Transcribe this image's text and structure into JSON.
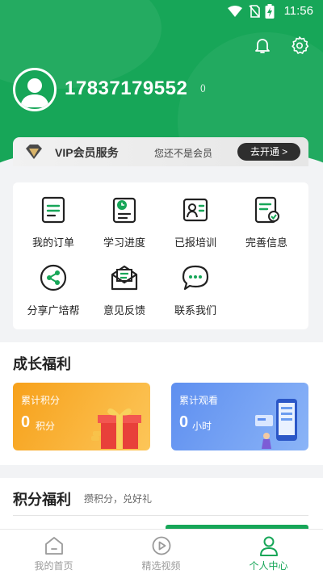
{
  "status_bar": {
    "time": "11:56"
  },
  "profile": {
    "phone": "17837179552",
    "tag": "()"
  },
  "vip": {
    "title": "VIP会员服务",
    "status": "您还不是会员",
    "button": "去开通 >"
  },
  "menu": [
    {
      "label": "我的订单",
      "icon": "order-icon"
    },
    {
      "label": "学习进度",
      "icon": "progress-icon"
    },
    {
      "label": "已报培训",
      "icon": "training-icon"
    },
    {
      "label": "完善信息",
      "icon": "profile-info-icon"
    },
    {
      "label": "分享广培帮",
      "icon": "share-icon"
    },
    {
      "label": "意见反馈",
      "icon": "feedback-icon"
    },
    {
      "label": "联系我们",
      "icon": "contact-icon"
    }
  ],
  "growth": {
    "title": "成长福利",
    "cards": [
      {
        "title": "累计积分",
        "value": "0",
        "unit": "积分",
        "color": "#f8a61c"
      },
      {
        "title": "累计观看",
        "value": "0",
        "unit": "小时",
        "color": "#6b9df0"
      }
    ]
  },
  "points": {
    "title": "积分福利",
    "subtitle": "攒积分，兑好礼"
  },
  "tabs": [
    {
      "label": "我的首页",
      "icon": "home-icon",
      "active": false
    },
    {
      "label": "精选视频",
      "icon": "video-icon",
      "active": false
    },
    {
      "label": "个人中心",
      "icon": "person-icon",
      "active": true
    }
  ],
  "colors": {
    "brand": "#17a658",
    "vip_button": "#2e2e2e"
  }
}
